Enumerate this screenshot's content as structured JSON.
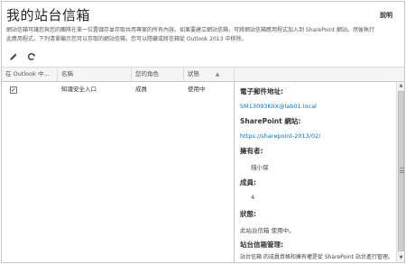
{
  "page": {
    "title": "我的站台信箱",
    "help_label": "說明",
    "description_lines": [
      "網站信箱可讓您與您的團隊在單一位置儲存並存取共用專案的所有內容。如果要建立網站信箱，可將網站信箱應用程式加入到 SharePoint 網站。然後執行",
      "此應用程式，下列清單顯示您可以存取的網站信箱，您可以隱藏或將信箱從 Outlook 2013 中移除。"
    ]
  },
  "toolbar": {
    "edit_icon": "pencil-icon",
    "refresh_icon": "refresh-icon"
  },
  "grid": {
    "columns": [
      "在 Outlook 中...",
      "名稱",
      "您的角色",
      "狀態"
    ],
    "sort_indicator": "▲",
    "rows": [
      {
        "checked": true,
        "check_glyph": "✓",
        "name": "知識安全入口",
        "role": "成員",
        "status": "使用中"
      }
    ]
  },
  "details": {
    "email_label": "電子郵件地址:",
    "email_value": "SM13093KIIX@lab01.local",
    "sharepoint_label": "SharePoint 網站:",
    "sharepoint_value": "https://sharepoint-2013/02/",
    "owner_label": "擁有者:",
    "owner_value": "錢小保",
    "members_label": "成員:",
    "members_value": "4",
    "status_label": "狀態:",
    "status_value": "此站台信箱 使用中。",
    "manage_label": "站台信箱管理:",
    "manage_value": "站台信箱 的成員資格和擁有權是從 SharePoint 站台進行管理。"
  },
  "scrollbar": {
    "up_icon": "▲",
    "down_icon": "▼"
  },
  "colors": {
    "accent": "#0072c6",
    "border": "#c6c6c6",
    "header_bg": "#f5f5f5"
  }
}
